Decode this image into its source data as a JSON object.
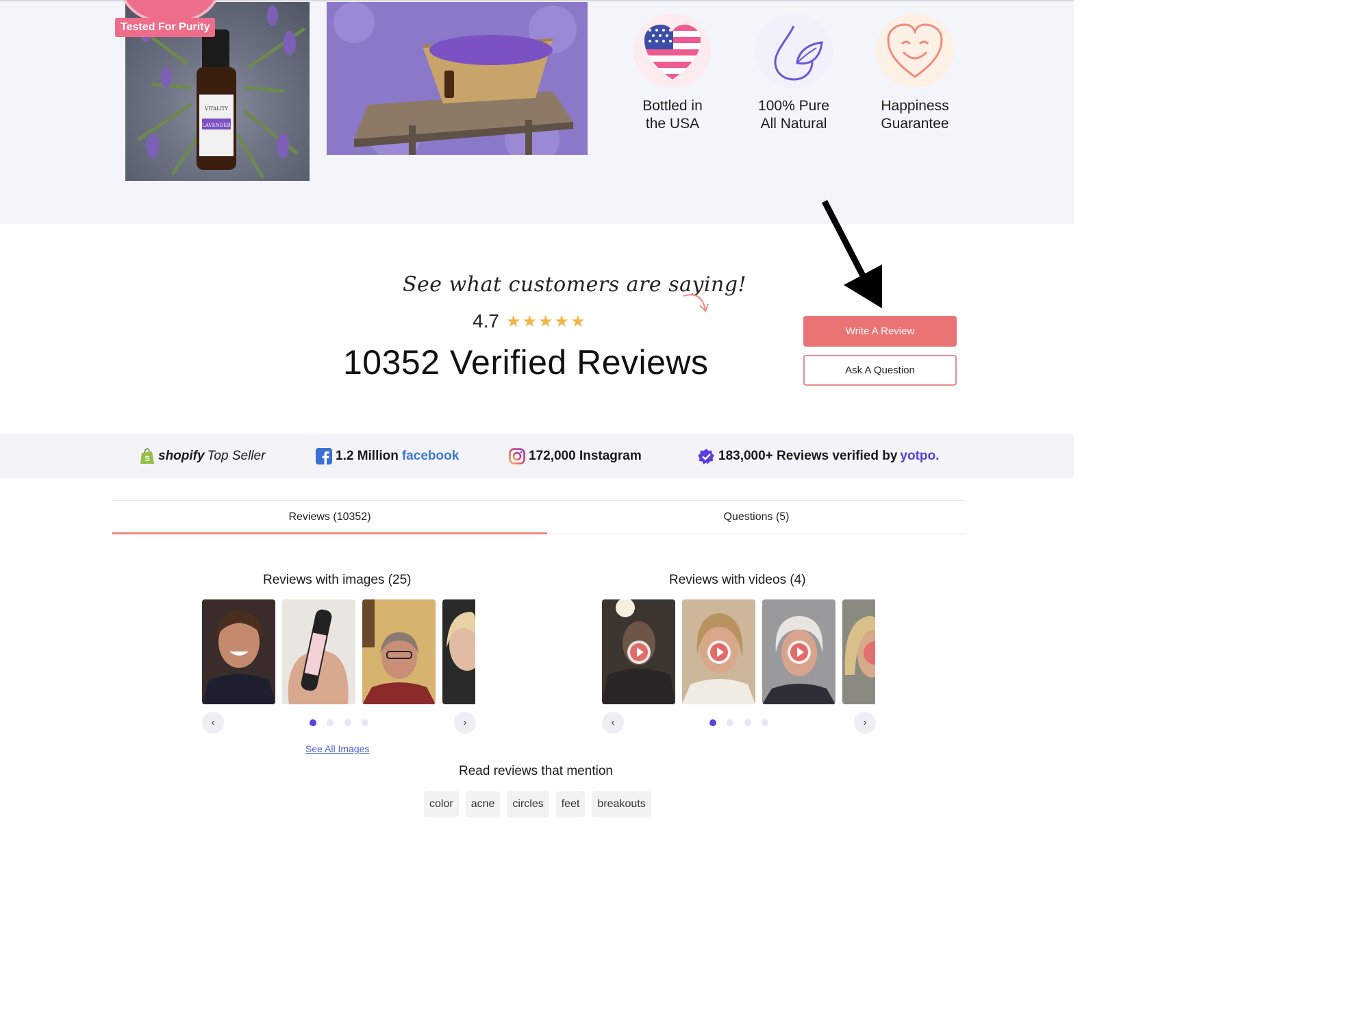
{
  "hero": {
    "purity_badge": "Tested For Purity",
    "bottle_label_brand": "VITALITY",
    "bottle_label_product": "LAVENDER",
    "features": [
      {
        "label_line1": "Bottled in",
        "label_line2": "the USA",
        "icon": "usa-heart-icon"
      },
      {
        "label_line1": "100% Pure",
        "label_line2": "All Natural",
        "icon": "water-drop-leaf-icon"
      },
      {
        "label_line1": "Happiness",
        "label_line2": "Guarantee",
        "icon": "smiling-heart-icon"
      }
    ]
  },
  "reviews_header": {
    "tagline": "See what customers are saying!",
    "rating": "4.7",
    "stars": 5,
    "title": "10352 Verified Reviews",
    "write_review_label": "Write A Review",
    "ask_question_label": "Ask A Question"
  },
  "trust_bar": {
    "shopify_word": "shopify",
    "shopify_tail": "Top Seller",
    "facebook_count": "1.2 Million",
    "facebook_word": "facebook",
    "instagram_text": "172,000 Instagram",
    "yotpo_text": "183,000+ Reviews verified by",
    "yotpo_word": "yotpo."
  },
  "tabs": {
    "reviews": "Reviews (10352)",
    "questions": "Questions (5)",
    "active": "reviews"
  },
  "galleries": {
    "images_title": "Reviews with images (25)",
    "videos_title": "Reviews with videos (4)",
    "image_pages": 4,
    "video_pages": 4,
    "active_page": 1,
    "see_all_images": "See All Images"
  },
  "mentions": {
    "title": "Read reviews that mention",
    "tags": [
      "color",
      "acne",
      "circles",
      "feet",
      "breakouts"
    ]
  },
  "colors": {
    "accent": "#ea7473",
    "star": "#f3b545",
    "dot_active": "#5b3fe0",
    "band": "#f4f4fb"
  }
}
